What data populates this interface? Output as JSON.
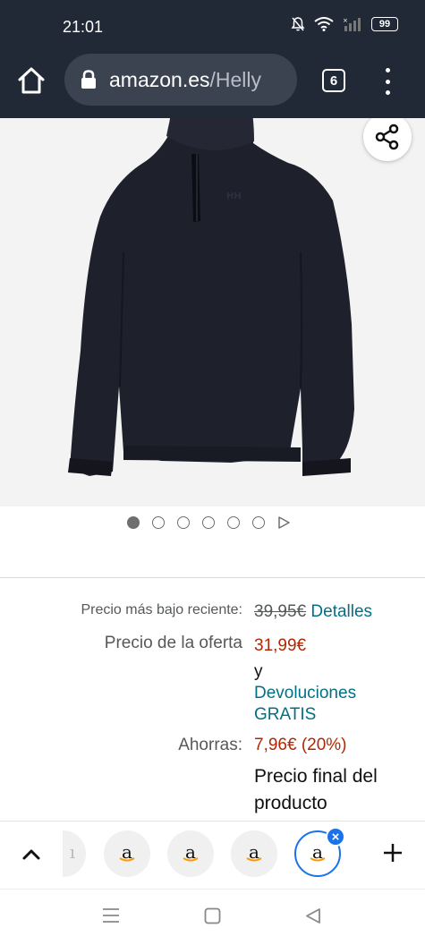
{
  "status_bar": {
    "time": "21:01",
    "battery": "99"
  },
  "browser": {
    "url_domain": "amazon.es",
    "url_path": "/Helly",
    "tab_count": "6"
  },
  "product": {
    "image_alt": "Helly Hansen 1/2 zip fleece pullover, navy"
  },
  "carousel": {
    "dot_count": 6,
    "active_index": 0
  },
  "pricing": {
    "recent_low_label": "Precio más bajo reciente:",
    "recent_low_value": "39,95€",
    "details_link": "Detalles",
    "offer_label": "Precio de la oferta",
    "offer_value": "31,99€",
    "and_text": "y",
    "returns_line1": "Devoluciones",
    "returns_line2": "GRATIS",
    "savings_label": "Ahorras:",
    "savings_value": "7,96€ (20%)",
    "final_line1": "Precio final del",
    "final_line2": "producto"
  },
  "tab_strip": {
    "tabs": [
      "a",
      "a",
      "a",
      "a"
    ]
  },
  "colors": {
    "topbar": "#212936",
    "link": "#007185",
    "price_red": "#b12704",
    "active_tab": "#1a73e8"
  }
}
